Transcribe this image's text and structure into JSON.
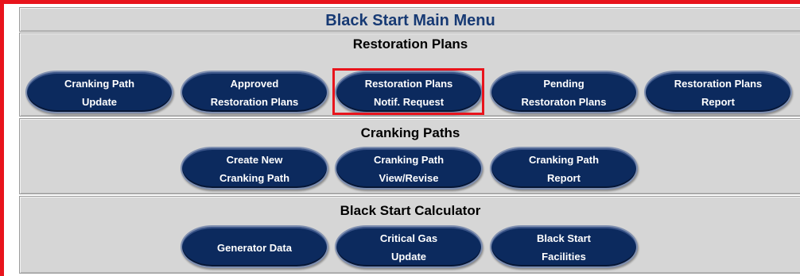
{
  "window": {
    "title": "Black Start Main Menu"
  },
  "sections": [
    {
      "title": "Restoration Plans",
      "buttons": [
        {
          "line1": "Cranking Path",
          "line2": "Update"
        },
        {
          "line1": "Approved",
          "line2": "Restoration Plans"
        },
        {
          "line1": "Restoration Plans",
          "line2": "Notif. Request"
        },
        {
          "line1": "Pending",
          "line2": "Restoraton Plans"
        },
        {
          "line1": "Restoration Plans",
          "line2": "Report"
        }
      ]
    },
    {
      "title": "Cranking Paths",
      "buttons": [
        {
          "line1": "Create New",
          "line2": "Cranking Path"
        },
        {
          "line1": "Cranking Path",
          "line2": "View/Revise"
        },
        {
          "line1": "Cranking Path",
          "line2": "Report"
        }
      ]
    },
    {
      "title": "Black Start Calculator",
      "buttons": [
        {
          "line1": "Generator Data",
          "line2": ""
        },
        {
          "line1": "Critical Gas",
          "line2": "Update"
        },
        {
          "line1": "Black Start",
          "line2": "Facilities"
        }
      ]
    }
  ],
  "colors": {
    "button": "#0c2a5e",
    "title": "#173a74",
    "highlight": "#e8141c",
    "panel": "#d6d6d6"
  }
}
